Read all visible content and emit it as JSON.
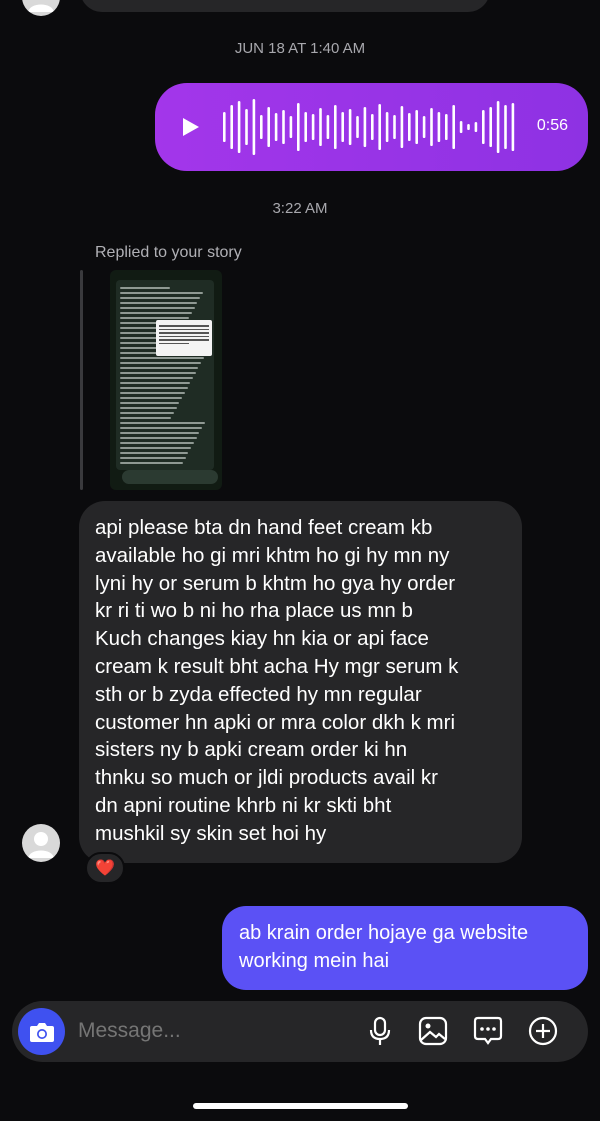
{
  "thread": {
    "timestamp_1": "JUN 18 AT 1:40 AM",
    "timestamp_2": "3:22 AM"
  },
  "voice_message": {
    "duration": "0:56",
    "icon": "play-icon",
    "color": "#9b35e8"
  },
  "story_reply": {
    "label": "Replied to your story"
  },
  "incoming_message": {
    "lines": [
      "api please bta dn hand feet cream kb",
      "available ho gi mri khtm ho gi hy mn ny",
      "lyni hy or serum b khtm ho gya hy order",
      "kr ri ti wo b ni ho rha place us mn b",
      "Kuch changes kiay hn kia or api face",
      "cream k result bht acha Hy mgr serum k",
      "sth or b zyda effected hy mn regular",
      "customer hn apki or mra color dkh k mri",
      "sisters ny b apki cream order ki hn",
      "thnku so much or jldi products avail kr",
      "dn apni routine khrb ni kr skti bht",
      "mushkil sy skin set hoi hy"
    ],
    "reaction": "❤️"
  },
  "outgoing_message": {
    "text": "ab krain order hojaye ga website working mein hai",
    "color": "#5b51f5"
  },
  "composer": {
    "placeholder": "Message...",
    "icons": [
      "camera-icon",
      "microphone-icon",
      "gallery-icon",
      "sticker-icon",
      "plus-icon"
    ]
  }
}
